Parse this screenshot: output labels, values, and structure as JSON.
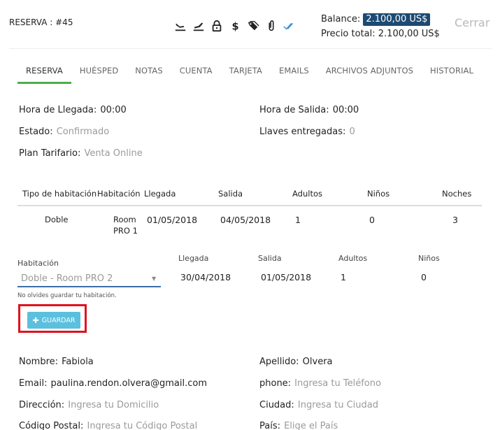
{
  "header": {
    "title": "RESERVA : #45",
    "icons": [
      "plane-landing-icon",
      "plane-departure-icon",
      "lock-icon",
      "dollar-icon",
      "tag-icon",
      "paperclip-icon",
      "double-check-icon"
    ],
    "balance_label": "Balance:",
    "balance_value": "2.100,00 US$",
    "total_label": "Precio total:",
    "total_value": "2.100,00 US$",
    "close_label": "Cerrar"
  },
  "tabs": [
    "RESERVA",
    "HUÉSPED",
    "NOTAS",
    "CUENTA",
    "TARJETA",
    "EMAILS",
    "ARCHIVOS ADJUNTOS",
    "HISTORIAL"
  ],
  "info": {
    "arrival_time_label": "Hora de Llegada:",
    "arrival_time_value": "00:00",
    "departure_time_label": "Hora de Salida:",
    "departure_time_value": "00:00",
    "status_label": "Estado:",
    "status_value": "Confirmado",
    "keys_label": "Llaves entregadas:",
    "keys_value": "0",
    "rate_plan_label": "Plan Tarifario:",
    "rate_plan_value": "Venta Online"
  },
  "table": {
    "headers": [
      "Tipo de habitación",
      "Habitación",
      "Llegada",
      "Salida",
      "Adultos",
      "Niños",
      "Noches"
    ],
    "row": {
      "type": "Doble",
      "room_line1": "Room",
      "room_line2": "PRO 1",
      "arrival": "01/05/2018",
      "departure": "04/05/2018",
      "adults": "1",
      "children": "0",
      "nights": "3"
    }
  },
  "edit": {
    "room_label": "Habitación",
    "room_value": "Doble - Room PRO 2",
    "arrival_label": "Llegada",
    "arrival_value": "30/04/2018",
    "departure_label": "Salida",
    "departure_value": "01/05/2018",
    "adults_label": "Adultos",
    "adults_value": "1",
    "children_label": "Niños",
    "children_value": "0",
    "hint": "No olvides guardar tu habitación.",
    "save_label": "GUARDAR"
  },
  "guest": {
    "first_name_label": "Nombre:",
    "first_name_value": "Fabiola",
    "last_name_label": "Apellido:",
    "last_name_value": "Olvera",
    "email_label": "Email:",
    "email_value": "paulina.rendon.olvera@gmail.com",
    "phone_label": "phone:",
    "phone_placeholder": "Ingresa tu Teléfono",
    "address_label": "Dirección:",
    "address_placeholder": "Ingresa tu Domicilio",
    "city_label": "Ciudad:",
    "city_placeholder": "Ingresa tu Ciudad",
    "zip_label": "Código Postal:",
    "zip_placeholder": "Ingresa tu Código Postal",
    "country_label": "País:",
    "country_placeholder": "Elige el País"
  },
  "colors": {
    "accent_tab": "#4cae4c",
    "balance_badge": "#1d4a73",
    "save_button": "#5bc0de",
    "highlight": "#e0121e"
  }
}
